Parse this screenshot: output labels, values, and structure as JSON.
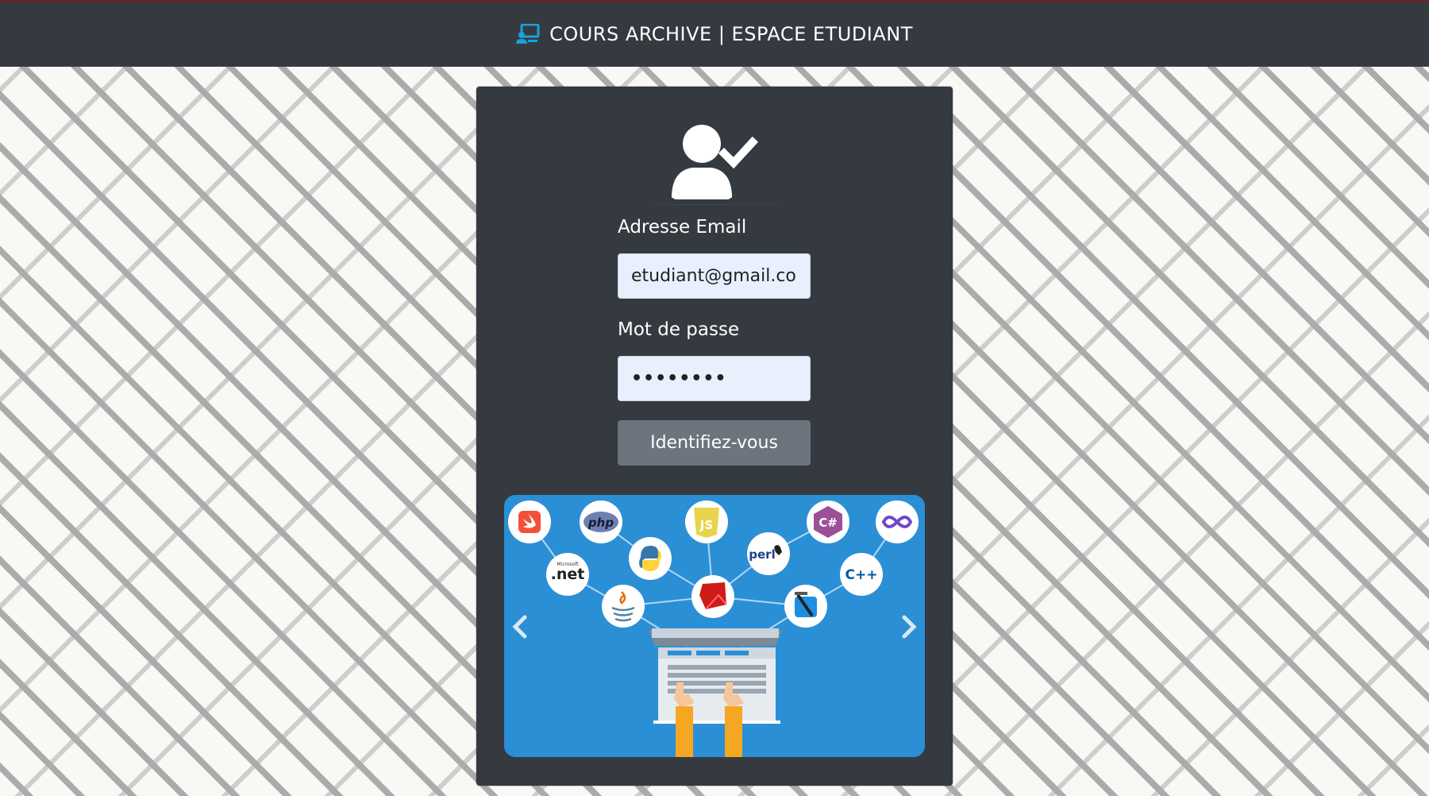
{
  "header": {
    "brand_icon": "monitor-user-icon",
    "title": "COURS ARCHIVE | ESPACE ETUDIANT"
  },
  "login": {
    "icon": "user-check-icon",
    "email_label": "Adresse Email",
    "email_value": "etudiant@gmail.co",
    "password_label": "Mot de passe",
    "password_value": "••••••••",
    "submit_label": "Identifiez-vous"
  },
  "carousel": {
    "prev_icon": "chevron-left-icon",
    "next_icon": "chevron-right-icon",
    "logos": {
      "php": "php",
      "net_small": "Microsoft",
      "net": ".net",
      "js": "JS",
      "perl": "perl",
      "cpp": "C++",
      "csharp": "C#"
    }
  },
  "colors": {
    "navbar": "#343a40",
    "card": "#343a40",
    "input_bg": "#e8f0fe",
    "button": "#6c757d",
    "carousel_bg": "#2b8fd6",
    "accent_icon": "#17a2d8"
  }
}
